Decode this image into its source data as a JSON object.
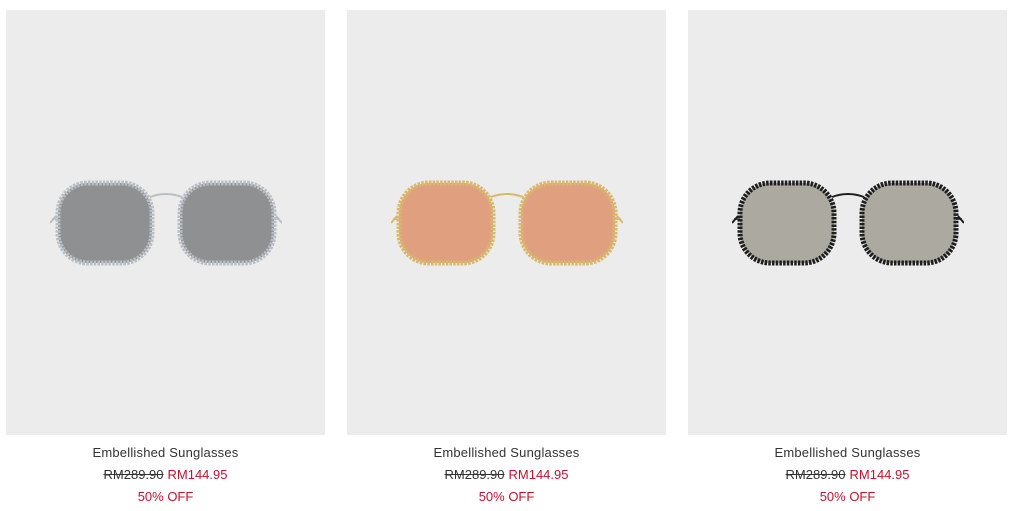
{
  "products": [
    {
      "name": "Embellished Sunglasses",
      "original_price": "RM289.90",
      "sale_price": "RM144.95",
      "discount": "50% OFF",
      "frame_color": "#b8bec4",
      "lens_color": "#8f9091",
      "icon": "sunglasses-silver-icon"
    },
    {
      "name": "Embellished Sunglasses",
      "original_price": "RM289.90",
      "sale_price": "RM144.95",
      "discount": "50% OFF",
      "frame_color": "#d8b86a",
      "lens_color": "#e0a080",
      "icon": "sunglasses-gold-icon"
    },
    {
      "name": "Embellished Sunglasses",
      "original_price": "RM289.90",
      "sale_price": "RM144.95",
      "discount": "50% OFF",
      "frame_color": "#1e1e1e",
      "lens_color": "#aca9a0",
      "icon": "sunglasses-black-icon"
    }
  ],
  "colors": {
    "card_bg": "#ececec",
    "sale": "#c8102e",
    "text": "#333333"
  }
}
